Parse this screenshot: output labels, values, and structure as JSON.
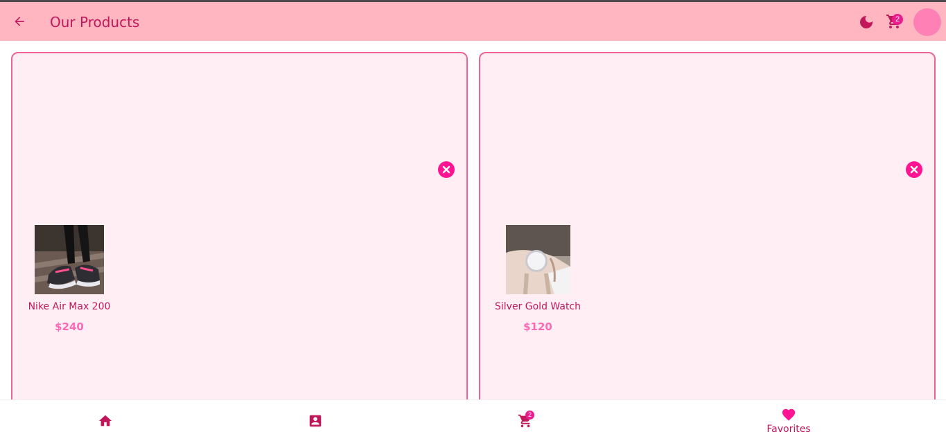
{
  "appbar": {
    "title": "Our Products",
    "cart_count": "2",
    "icons": {
      "back": "arrow-back-icon",
      "theme": "moon-icon",
      "cart": "cart-icon",
      "avatar": "avatar"
    }
  },
  "favorites": [
    {
      "name": "Nike Air Max 200",
      "price": "$240",
      "image": "sneaker-photo"
    },
    {
      "name": "Silver Gold Watch",
      "price": "$120",
      "image": "watch-photo"
    }
  ],
  "bottom_nav": {
    "items": [
      {
        "icon": "home-icon",
        "label": ""
      },
      {
        "icon": "profile-icon",
        "label": ""
      },
      {
        "icon": "cart-icon",
        "label": "",
        "badge": "2"
      },
      {
        "icon": "heart-icon",
        "label": "Favorites"
      }
    ],
    "active": "Favorites"
  },
  "colors": {
    "appbar_bg": "#ffb6c1",
    "accent": "#c2185b",
    "card_bg": "#ffeef4",
    "card_border": "#f06292",
    "badge": "#e91e8c",
    "remove": "#ff1493",
    "price": "#ff69b4"
  }
}
